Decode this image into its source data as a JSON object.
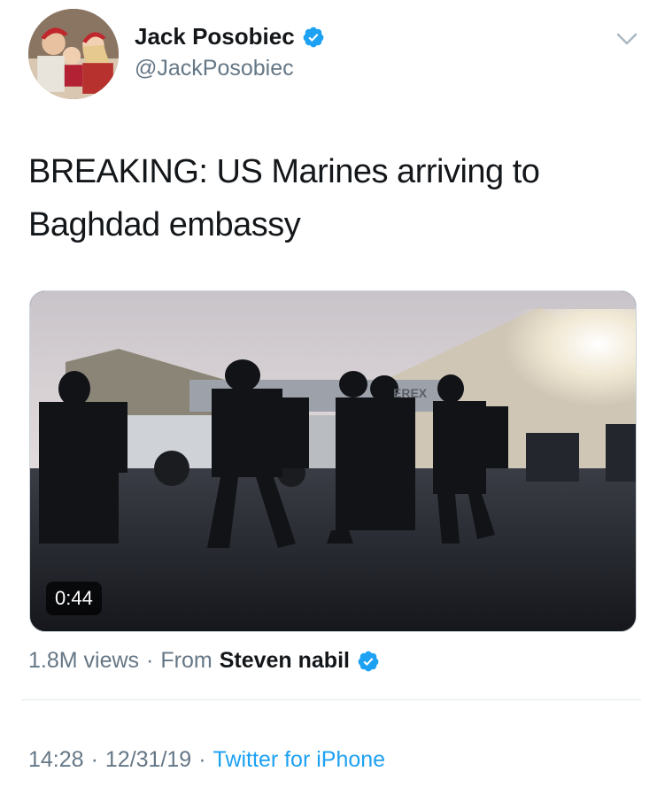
{
  "tweet": {
    "author": {
      "name": "Jack Posobiec",
      "handle": "@JackPosobiec",
      "verified": true
    },
    "text": "BREAKING: US Marines arriving to Baghdad embassy",
    "video": {
      "duration": "0:44",
      "watermark": "EREX"
    },
    "views": "1.8M views",
    "separator": "·",
    "from_label": "From",
    "from_name": "Steven nabil",
    "from_verified": true,
    "time": "14:28",
    "date": "12/31/19",
    "source": "Twitter for iPhone"
  },
  "colors": {
    "verified_blue": "#1da1f2",
    "link_blue": "#1da1f2",
    "secondary_text": "#657786"
  },
  "icons": {
    "verified": "verified-badge-icon",
    "menu": "chevron-down-icon"
  }
}
